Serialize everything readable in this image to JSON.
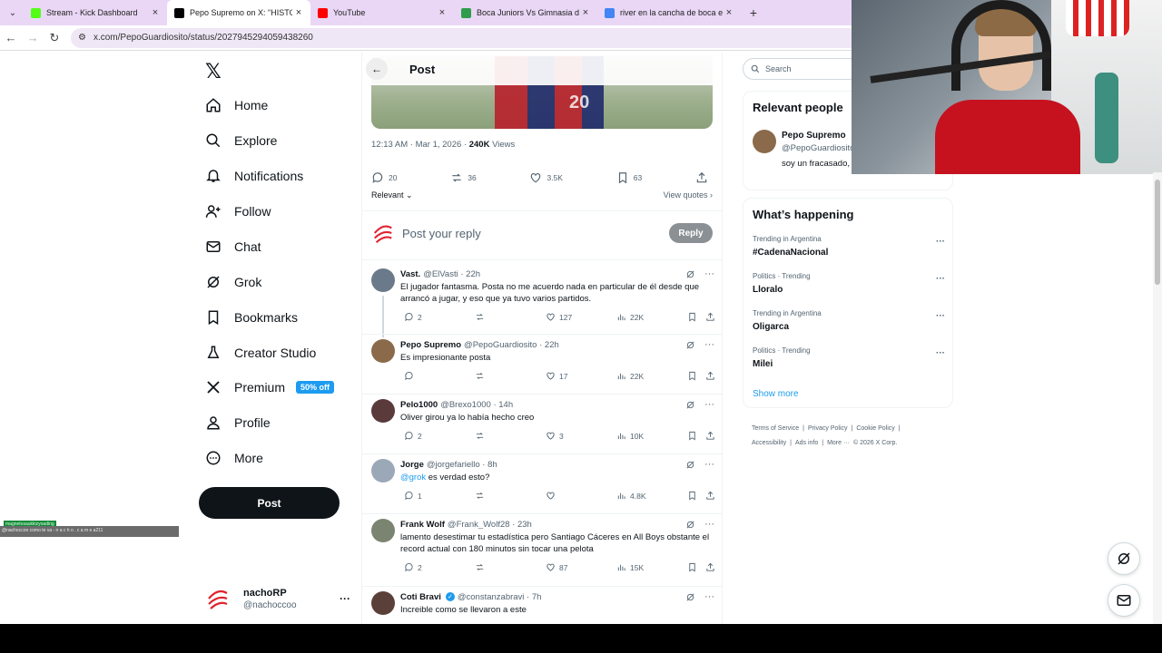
{
  "browser": {
    "tabs": [
      {
        "title": "Stream - Kick Dashboard",
        "favicon": "kick",
        "color": "#53fc18"
      },
      {
        "title": "Pepo Supremo on X: \"HISTORIA",
        "favicon": "x",
        "color": "#000000",
        "active": true
      },
      {
        "title": "YouTube",
        "favicon": "youtube",
        "color": "#ff0000"
      },
      {
        "title": "Boca Juniors Vs Gimnasia de M",
        "favicon": "globe",
        "color": "#2e9c4a"
      },
      {
        "title": "river en la cancha de boca en e",
        "favicon": "google",
        "color": "#4285f4"
      }
    ],
    "url": "x.com/PepoGuardiosito/status/2027945294059438260"
  },
  "nav": {
    "items": [
      {
        "label": "Home",
        "icon": "home-icon"
      },
      {
        "label": "Explore",
        "icon": "search-icon"
      },
      {
        "label": "Notifications",
        "icon": "bell-icon"
      },
      {
        "label": "Follow",
        "icon": "follow-icon"
      },
      {
        "label": "Chat",
        "icon": "mail-icon"
      },
      {
        "label": "Grok",
        "icon": "grok-icon"
      },
      {
        "label": "Bookmarks",
        "icon": "bookmark-icon"
      },
      {
        "label": "Creator Studio",
        "icon": "flask-icon"
      },
      {
        "label": "Premium",
        "icon": "x-icon",
        "badge": "50% off"
      },
      {
        "label": "Profile",
        "icon": "person-icon"
      },
      {
        "label": "More",
        "icon": "more-icon"
      }
    ],
    "post_button": "Post",
    "account": {
      "name": "nachoRP",
      "handle": "@nachoccoo"
    }
  },
  "overlay": {
    "line1": "magnetosaukkizyoading",
    "line2": "@nachoccoo como te va - n a c h o . c a m e a211"
  },
  "header": {
    "title": "Post"
  },
  "post": {
    "time": "12:13 AM · Mar 1, 2026 · ",
    "views_count": "240K",
    "views_label": " Views",
    "stats": {
      "replies": "20",
      "reposts": "36",
      "likes": "3.5K",
      "bookmarks": "63"
    },
    "sort_label": "Relevant",
    "view_quotes": "View quotes"
  },
  "reply_box": {
    "placeholder": "Post your reply",
    "button": "Reply"
  },
  "replies": [
    {
      "name": "Vast.",
      "handle": "@ElVasti",
      "time": "22h",
      "text": "El jugador fantasma. Posta no me acuerdo nada en particular de él desde que arrancó a jugar, y eso que ya tuvo varios partidos.",
      "replies": "2",
      "reposts": "",
      "likes": "127",
      "views": "22K",
      "avatar_color": "#6b7a8a"
    },
    {
      "name": "Pepo Supremo",
      "handle": "@PepoGuardiosito",
      "time": "22h",
      "text": "Es impresionante posta",
      "replies": "",
      "reposts": "",
      "likes": "17",
      "views": "22K",
      "avatar_color": "#8a6a4a"
    },
    {
      "name": "Pelo1000",
      "handle": "@Brexo1000",
      "time": "14h",
      "text": "Oliver girou ya lo había hecho creo",
      "replies": "2",
      "reposts": "",
      "likes": "3",
      "views": "10K",
      "avatar_color": "#5a3a3a"
    },
    {
      "name": "Jorge",
      "handle": "@jorgefariello",
      "time": "8h",
      "text_mention": "@grok",
      "text": " es verdad esto?",
      "replies": "1",
      "reposts": "",
      "likes": "",
      "views": "4.8K",
      "avatar_color": "#9aa8b8"
    },
    {
      "name": "Frank Wolf",
      "handle": "@Frank_Wolf28",
      "time": "23h",
      "text": "lamento desestimar tu estadística pero Santiago Cáceres en All Boys obstante el record actual con 180 minutos sin tocar una pelota",
      "replies": "2",
      "reposts": "",
      "likes": "87",
      "views": "15K",
      "avatar_color": "#7b8470"
    },
    {
      "name": "Coti Bravi",
      "handle": "@constanzabravi",
      "time": "7h",
      "text": "Increible como se llevaron a este",
      "replies": "",
      "reposts": "",
      "likes": "",
      "views": "",
      "avatar_color": "#5a4038",
      "verified": true
    }
  ],
  "search": {
    "placeholder": "Search"
  },
  "relevant": {
    "title": "Relevant people",
    "name": "Pepo Supremo",
    "handle": "@PepoGuardiosito",
    "bio": "soy un fracasado, de puta"
  },
  "happening": {
    "title": "What’s happening",
    "trends": [
      {
        "category": "Trending in Argentina",
        "topic": "#CadenaNacional"
      },
      {
        "category": "Politics · Trending",
        "topic": "Lloralo"
      },
      {
        "category": "Trending in Argentina",
        "topic": "Oligarca"
      },
      {
        "category": "Politics · Trending",
        "topic": "Milei"
      }
    ],
    "show_more": "Show more"
  },
  "footer": {
    "links": [
      "Terms of Service",
      "|",
      "Privacy Policy",
      "|",
      "Cookie Policy",
      "|",
      "Accessibility",
      "|",
      "Ads info",
      "|",
      "More ···",
      "© 2026 X Corp."
    ]
  }
}
